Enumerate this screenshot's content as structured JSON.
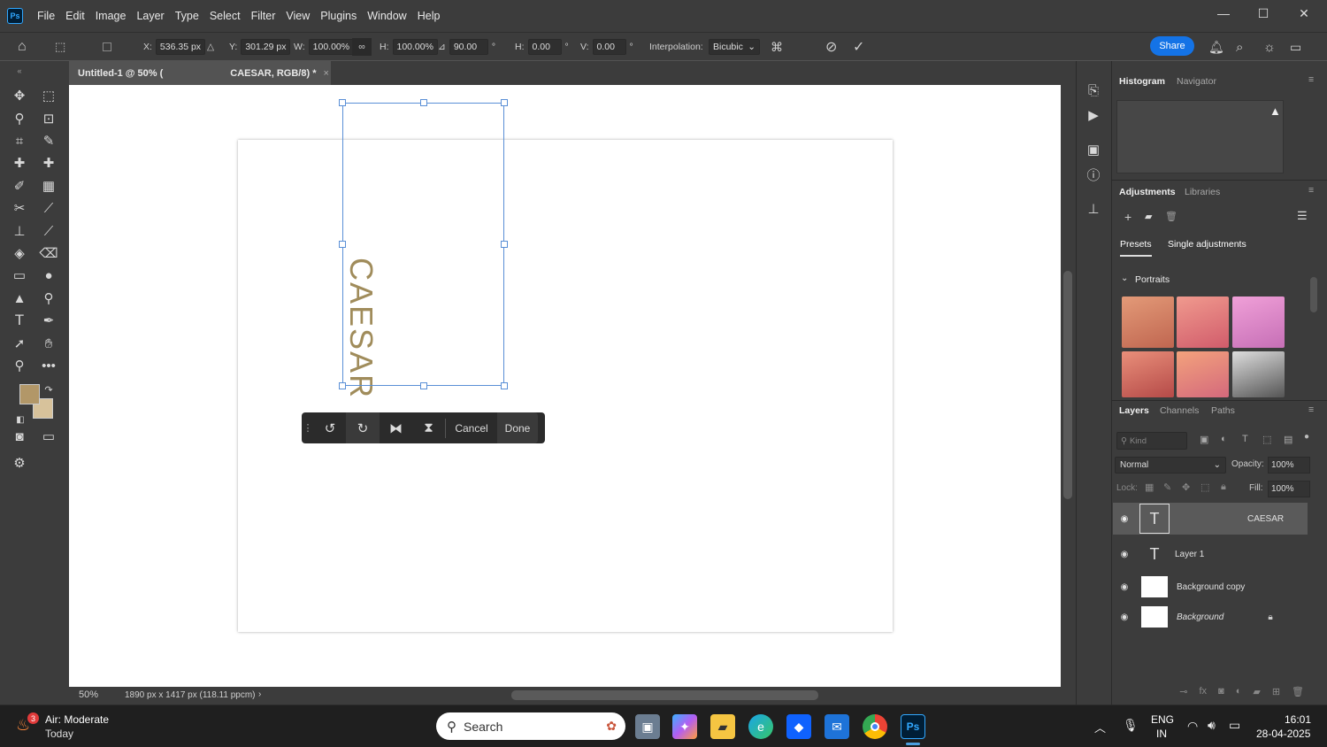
{
  "app": {
    "logo": "Ps",
    "menus": [
      "File",
      "Edit",
      "Image",
      "Layer",
      "Type",
      "Select",
      "Filter",
      "View",
      "Plugins",
      "Window",
      "Help"
    ]
  },
  "window_controls": {
    "minimize": "—",
    "maximize": "☐",
    "close": "✕"
  },
  "options": {
    "x_label": "X:",
    "x_value": "536.35 px",
    "y_label": "Y:",
    "y_value": "301.29 px",
    "w_label": "W:",
    "w_value": "100.00%",
    "h_label": "H:",
    "h_value": "100.00%",
    "angle_value": "90.00",
    "angle_unit": "°",
    "hskew_label": "H:",
    "hskew_value": "0.00",
    "hskew_unit": "°",
    "vskew_label": "V:",
    "vskew_value": "0.00",
    "vskew_unit": "°",
    "interp_label": "Interpolation:",
    "interp_value": "Bicubic",
    "share_label": "Share"
  },
  "tab": {
    "title": "Untitled-1 @ 50% (",
    "title_layer": "CAESAR, RGB/8) *",
    "close": "×"
  },
  "canvas": {
    "text": "CAESAR",
    "text_color": "#a08c5b"
  },
  "context_bar": {
    "cancel": "Cancel",
    "done": "Done"
  },
  "status": {
    "zoom": "50%",
    "doc_info": "1890 px x 1417 px (118.11 ppcm)"
  },
  "colors": {
    "foreground": "#b29768",
    "background": "#d7c29b",
    "accent": "#1473e6"
  },
  "panels": {
    "histogram_tab": "Histogram",
    "navigator_tab": "Navigator",
    "adjustments_tab": "Adjustments",
    "libraries_tab": "Libraries",
    "presets_tab": "Presets",
    "single_tab": "Single adjustments",
    "portraits_label": "Portraits",
    "layers_tab": "Layers",
    "channels_tab": "Channels",
    "paths_tab": "Paths",
    "kind_placeholder": "Kind",
    "blend_mode": "Normal",
    "opacity_label": "Opacity:",
    "opacity_value": "100%",
    "lock_label": "Lock:",
    "fill_label": "Fill:",
    "fill_value": "100%",
    "layers": [
      {
        "name": "CAESAR"
      },
      {
        "name": "Layer 1"
      },
      {
        "name": "Background copy"
      },
      {
        "name": "Background"
      }
    ]
  },
  "taskbar": {
    "weather_badge": "3",
    "weather_title": "Air: Moderate",
    "weather_sub": "Today",
    "search_label": "Search",
    "lang_top": "ENG",
    "lang_bottom": "IN",
    "time": "16:01",
    "date": "28-04-2025"
  }
}
